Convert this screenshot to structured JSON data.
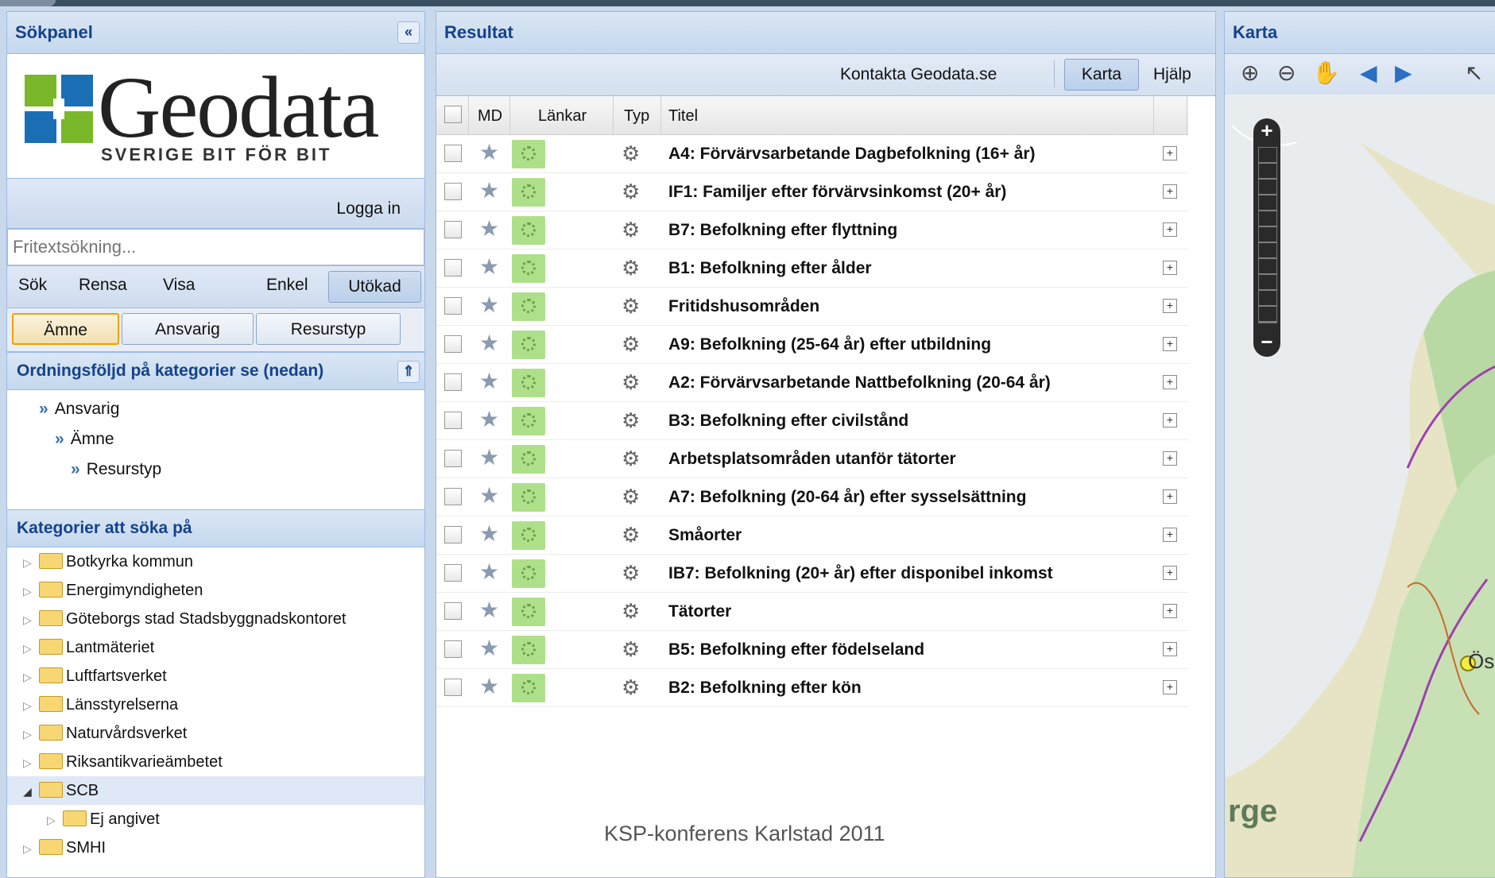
{
  "left_panel": {
    "title": "Sökpanel",
    "collapse_glyph": "«",
    "logo_word": "Geodata",
    "logo_tagline": "SVERIGE BIT FÖR BIT",
    "login_label": "Logga in",
    "search_placeholder": "Fritextsökning...",
    "toolbar": {
      "search": "Sök",
      "clear": "Rensa",
      "show": "Visa",
      "simple": "Enkel",
      "extended": "Utökad"
    },
    "tabs": [
      "Ämne",
      "Ansvarig",
      "Resurstyp"
    ],
    "order_title": "Ordningsföljd på kategorier se (nedan)",
    "order_items": [
      "Ansvarig",
      "Ämne",
      "Resurstyp"
    ],
    "categories_title": "Kategorier att söka på",
    "categories": [
      "Botkyrka kommun",
      "Energimyndigheten",
      "Göteborgs stad Stadsbyggnadskontoret",
      "Lantmäteriet",
      "Luftfartsverket",
      "Länsstyrelserna",
      "Naturvårdsverket",
      "Riksantikvarieämbetet",
      "SCB",
      "Ej angivet",
      "SMHI"
    ]
  },
  "results_panel": {
    "title": "Resultat",
    "contact_link": "Kontakta Geodata.se",
    "map_button": "Karta",
    "help_link": "Hjälp",
    "columns": {
      "md": "MD",
      "links": "Länkar",
      "type": "Typ",
      "title": "Titel"
    },
    "rows": [
      "A4: Förvärvsarbetande Dagbefolkning (16+ år)",
      "IF1: Familjer efter förvärvsinkomst (20+ år)",
      "B7: Befolkning efter flyttning",
      "B1: Befolkning efter ålder",
      "Fritidshusområden",
      "A9: Befolkning (25-64 år) efter utbildning",
      "A2: Förvärvsarbetande Nattbefolkning (20-64 år)",
      "B3: Befolkning efter civilstånd",
      "Arbetsplatsområden utanför tätorter",
      "A7: Befolkning (20-64 år) efter sysselsättning",
      "Småorter",
      "IB7: Befolkning (20+ år) efter disponibel inkomst",
      "Tätorter",
      "B5: Befolkning efter födelseland",
      "B2: Befolkning efter kön"
    ]
  },
  "map_panel": {
    "title": "Karta",
    "map_label": "rge",
    "city_label": "Ös"
  },
  "footer_note": "KSP-konferens Karlstad 2011",
  "colors": {
    "panel_title": "#15428b",
    "border": "#99bbe8",
    "accent_tab": "#f0a000"
  },
  "icons": [
    "zoom-in-icon",
    "zoom-out-icon",
    "pan-hand-icon",
    "back-icon",
    "forward-icon",
    "select-icon",
    "star-icon",
    "gear-icon",
    "folder-icon"
  ]
}
